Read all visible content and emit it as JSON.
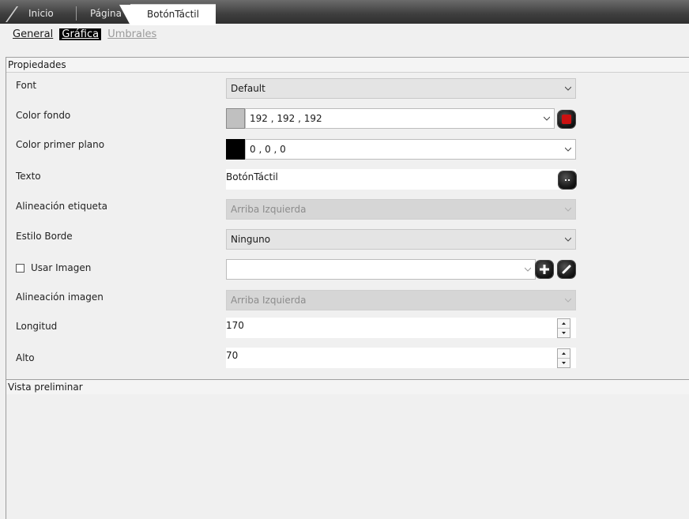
{
  "tabs": [
    {
      "label": "Inicio"
    },
    {
      "label": "Página"
    },
    {
      "label": "BotónTáctil",
      "active": true
    }
  ],
  "subtabs": [
    {
      "label": "General",
      "state": "normal"
    },
    {
      "label": "Gráfica",
      "state": "active"
    },
    {
      "label": "Umbrales",
      "state": "disabled"
    }
  ],
  "properties_header": "Propiedades",
  "rows": {
    "font": {
      "label": "Font",
      "value": "Default"
    },
    "color_fondo": {
      "label": "Color fondo",
      "value": "192 , 192 , 192",
      "swatch": "#c0c0c0"
    },
    "color_primer_plano": {
      "label": "Color primer plano",
      "value": "0 , 0 , 0",
      "swatch": "#000000"
    },
    "texto": {
      "label": "Texto",
      "value": "BotónTáctil",
      "button_glyph": ".."
    },
    "alineacion_etiqueta": {
      "label": "Alineación etiqueta",
      "value": "Arriba Izquierda"
    },
    "estilo_borde": {
      "label": "Estilo Borde",
      "value": "Ninguno"
    },
    "usar_imagen": {
      "label": "Usar Imagen",
      "checked": false,
      "value": ""
    },
    "alineacion_imagen": {
      "label": "Alineación imagen",
      "value": "Arriba Izquierda"
    },
    "longitud": {
      "label": "Longitud",
      "value": "170"
    },
    "alto": {
      "label": "Alto",
      "value": "70"
    }
  },
  "preview_header": "Vista preliminar",
  "colors": {
    "color_picker_button": "#cc1111",
    "accent_dark": "#1a1a1a"
  }
}
